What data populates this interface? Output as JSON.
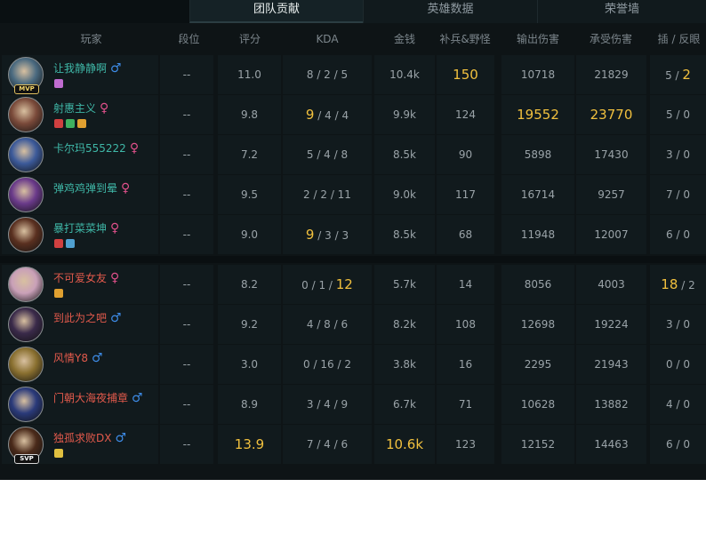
{
  "tabs": [
    {
      "label": "团队贡献",
      "active": true
    },
    {
      "label": "英雄数据",
      "active": false
    },
    {
      "label": "荣誉墙",
      "active": false
    }
  ],
  "columns": [
    "玩家",
    "段位",
    "评分",
    "KDA",
    "金钱",
    "补兵&野怪",
    "输出伤害",
    "承受伤害",
    "插 / 反眼"
  ],
  "colors": {
    "highlight": "#f1c03e",
    "blue_name": "#3fb7a7",
    "red_name": "#e35a4c",
    "male": "#3d8be6",
    "female": "#e0508a"
  },
  "team_blue": [
    {
      "name": "让我静静啊",
      "gender": "♂",
      "gender_type": "male",
      "badge": "MVP",
      "icons": [
        "skull-icon"
      ],
      "rank": "--",
      "score": "11.0",
      "k": "8",
      "d": "2",
      "a": "5",
      "gold": "10.4k",
      "cs": "150",
      "dmg": "10718",
      "taken": "21829",
      "ward": "5",
      "deward": "2",
      "hl": [
        "cs",
        "deward"
      ],
      "avatar_color": "#4a6a80"
    },
    {
      "name": "射惠主义",
      "gender": "♀",
      "gender_type": "female",
      "badge": "",
      "icons": [
        "swords-icon",
        "shield-icon",
        "crown-icon"
      ],
      "rank": "--",
      "score": "9.8",
      "k": "9",
      "d": "4",
      "a": "4",
      "gold": "9.9k",
      "cs": "124",
      "dmg": "19552",
      "taken": "23770",
      "ward": "5",
      "deward": "0",
      "hl": [
        "k",
        "dmg",
        "taken"
      ],
      "avatar_color": "#7a4a3a"
    },
    {
      "name": "卡尔玛555222",
      "gender": "♀",
      "gender_type": "female",
      "badge": "",
      "icons": [],
      "rank": "--",
      "score": "7.2",
      "k": "5",
      "d": "4",
      "a": "8",
      "gold": "8.5k",
      "cs": "90",
      "dmg": "5898",
      "taken": "17430",
      "ward": "3",
      "deward": "0",
      "hl": [],
      "avatar_color": "#3c5a9a"
    },
    {
      "name": "弹鸡鸡弹到晕",
      "gender": "♀",
      "gender_type": "female",
      "badge": "",
      "icons": [],
      "rank": "--",
      "score": "9.5",
      "k": "2",
      "d": "2",
      "a": "11",
      "gold": "9.0k",
      "cs": "117",
      "dmg": "16714",
      "taken": "9257",
      "ward": "7",
      "deward": "0",
      "hl": [],
      "avatar_color": "#6a3a8a"
    },
    {
      "name": "暴打菜菜坤",
      "gender": "♀",
      "gender_type": "female",
      "badge": "",
      "icons": [
        "swords-icon",
        "tower-icon"
      ],
      "rank": "--",
      "score": "9.0",
      "k": "9",
      "d": "3",
      "a": "3",
      "gold": "8.5k",
      "cs": "68",
      "dmg": "11948",
      "taken": "12007",
      "ward": "6",
      "deward": "0",
      "hl": [
        "k"
      ],
      "avatar_color": "#5a3020"
    }
  ],
  "team_red": [
    {
      "name": "不可爱女友",
      "gender": "♀",
      "gender_type": "female",
      "badge": "",
      "icons": [
        "fist-icon"
      ],
      "rank": "--",
      "score": "8.2",
      "k": "0",
      "d": "1",
      "a": "12",
      "gold": "5.7k",
      "cs": "14",
      "dmg": "8056",
      "taken": "4003",
      "ward": "18",
      "deward": "2",
      "hl": [
        "a",
        "ward"
      ],
      "avatar_color": "#c9a0b8"
    },
    {
      "name": "到此为之吧",
      "gender": "♂",
      "gender_type": "male",
      "badge": "",
      "icons": [],
      "rank": "--",
      "score": "9.2",
      "k": "4",
      "d": "8",
      "a": "6",
      "gold": "8.2k",
      "cs": "108",
      "dmg": "12698",
      "taken": "19224",
      "ward": "3",
      "deward": "0",
      "hl": [],
      "avatar_color": "#3a2a4a"
    },
    {
      "name": "风情Y8",
      "gender": "♂",
      "gender_type": "male",
      "badge": "",
      "icons": [],
      "rank": "--",
      "score": "3.0",
      "k": "0",
      "d": "16",
      "a": "2",
      "gold": "3.8k",
      "cs": "16",
      "dmg": "2295",
      "taken": "21943",
      "ward": "0",
      "deward": "0",
      "hl": [],
      "avatar_color": "#8a7030"
    },
    {
      "name": "门朝大海夜捕章",
      "gender": "♂",
      "gender_type": "male",
      "badge": "",
      "icons": [],
      "rank": "--",
      "score": "8.9",
      "k": "3",
      "d": "4",
      "a": "9",
      "gold": "6.7k",
      "cs": "71",
      "dmg": "10628",
      "taken": "13882",
      "ward": "4",
      "deward": "0",
      "hl": [],
      "avatar_color": "#2a3a7a"
    },
    {
      "name": "独孤求败DX",
      "gender": "♂",
      "gender_type": "male",
      "badge": "SVP",
      "icons": [
        "coin-icon"
      ],
      "rank": "--",
      "score": "13.9",
      "k": "7",
      "d": "4",
      "a": "6",
      "gold": "10.6k",
      "cs": "123",
      "dmg": "12152",
      "taken": "14463",
      "ward": "6",
      "deward": "0",
      "hl": [
        "score",
        "gold"
      ],
      "avatar_color": "#4a2a1a"
    }
  ]
}
